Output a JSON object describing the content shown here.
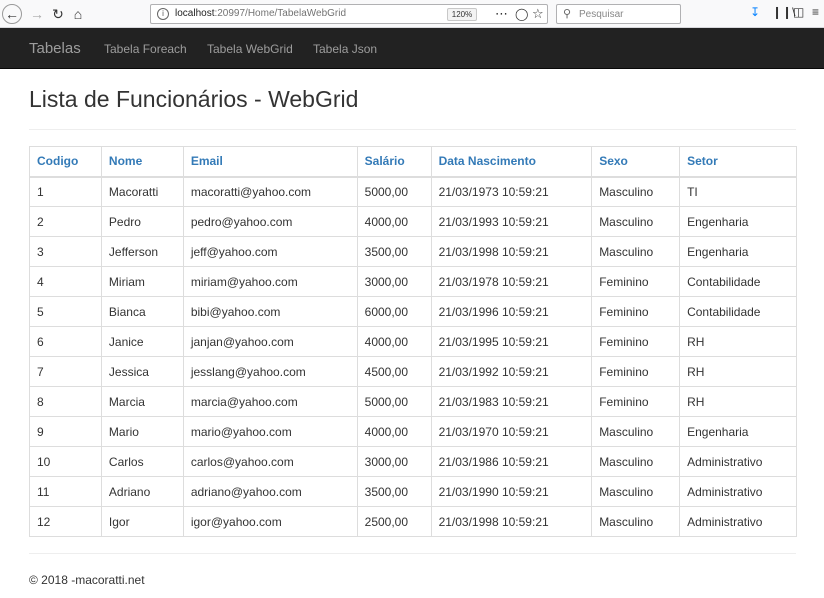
{
  "browser": {
    "url_host": "localhost",
    "url_rest": ":20997/Home/TabelaWebGrid",
    "zoom": "120%",
    "search_placeholder": "Pesquisar"
  },
  "navbar": {
    "brand": "Tabelas",
    "links": [
      "Tabela Foreach",
      "Tabela WebGrid",
      "Tabela Json"
    ]
  },
  "page": {
    "title": "Lista de Funcionários - WebGrid"
  },
  "table": {
    "columns": [
      "Codigo",
      "Nome",
      "Email",
      "Salário",
      "Data Nascimento",
      "Sexo",
      "Setor"
    ],
    "rows": [
      [
        "1",
        "Macoratti",
        "macoratti@yahoo.com",
        "5000,00",
        "21/03/1973 10:59:21",
        "Masculino",
        "TI"
      ],
      [
        "2",
        "Pedro",
        "pedro@yahoo.com",
        "4000,00",
        "21/03/1993 10:59:21",
        "Masculino",
        "Engenharia"
      ],
      [
        "3",
        "Jefferson",
        "jeff@yahoo.com",
        "3500,00",
        "21/03/1998 10:59:21",
        "Masculino",
        "Engenharia"
      ],
      [
        "4",
        "Miriam",
        "miriam@yahoo.com",
        "3000,00",
        "21/03/1978 10:59:21",
        "Feminino",
        "Contabilidade"
      ],
      [
        "5",
        "Bianca",
        "bibi@yahoo.com",
        "6000,00",
        "21/03/1996 10:59:21",
        "Feminino",
        "Contabilidade"
      ],
      [
        "6",
        "Janice",
        "janjan@yahoo.com",
        "4000,00",
        "21/03/1995 10:59:21",
        "Feminino",
        "RH"
      ],
      [
        "7",
        "Jessica",
        "jesslang@yahoo.com",
        "4500,00",
        "21/03/1992 10:59:21",
        "Feminino",
        "RH"
      ],
      [
        "8",
        "Marcia",
        "marcia@yahoo.com",
        "5000,00",
        "21/03/1983 10:59:21",
        "Feminino",
        "RH"
      ],
      [
        "9",
        "Mario",
        "mario@yahoo.com",
        "4000,00",
        "21/03/1970 10:59:21",
        "Masculino",
        "Engenharia"
      ],
      [
        "10",
        "Carlos",
        "carlos@yahoo.com",
        "3000,00",
        "21/03/1986 10:59:21",
        "Masculino",
        "Administrativo"
      ],
      [
        "11",
        "Adriano",
        "adriano@yahoo.com",
        "3500,00",
        "21/03/1990 10:59:21",
        "Masculino",
        "Administrativo"
      ],
      [
        "12",
        "Igor",
        "igor@yahoo.com",
        "2500,00",
        "21/03/1998 10:59:21",
        "Masculino",
        "Administrativo"
      ]
    ]
  },
  "footer": {
    "text": "© 2018 -macoratti.net"
  },
  "icons": {
    "back": "back-arrow-icon",
    "forward": "forward-arrow-icon",
    "reload": "reload-icon",
    "home": "home-icon",
    "info": "info-icon",
    "more": "more-actions-icon",
    "pocket": "pocket-icon",
    "bookmark": "bookmark-star-icon",
    "search": "search-icon",
    "download": "download-icon",
    "library": "library-icon",
    "sidebar": "sidebar-icon"
  },
  "colors": {
    "navbar_bg": "#222222",
    "nav_text": "#9d9d9d",
    "header_link": "#337ab7",
    "download_icon": "#0a84ff"
  }
}
